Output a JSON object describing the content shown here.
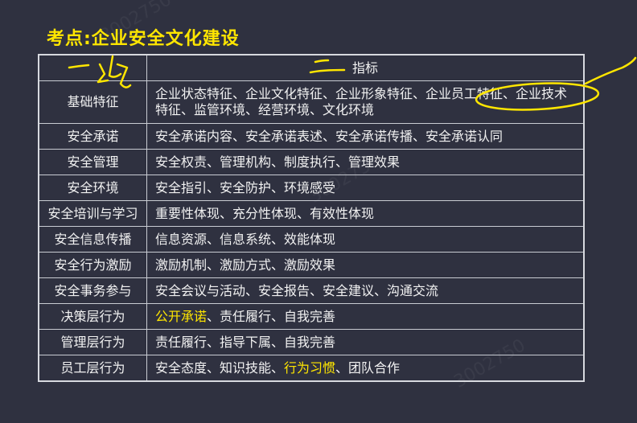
{
  "title": "考点:企业安全文化建设",
  "table": {
    "header": {
      "col1": "",
      "col2": "指标"
    },
    "rows": [
      {
        "category": "基础特征",
        "indicators": "企业状态特征、企业文化特征、企业形象特征、企业员工特征、企业技术特征、监管环境、经营环境、文化环境",
        "cat_highlight": false,
        "ind_highlight": false
      },
      {
        "category": "安全承诺",
        "indicators": "安全承诺内容、安全承诺表述、安全承诺传播、安全承诺认同",
        "cat_highlight": false,
        "ind_highlight": false
      },
      {
        "category": "安全管理",
        "indicators": "安全权责、管理机构、制度执行、管理效果",
        "cat_highlight": true,
        "ind_highlight": true
      },
      {
        "category": "安全环境",
        "indicators": "安全指引、安全防护、环境感受",
        "cat_highlight": false,
        "ind_highlight": false
      },
      {
        "category": "安全培训与学习",
        "indicators": "重要性体现、充分性体现、有效性体现",
        "cat_highlight": true,
        "ind_highlight": true
      },
      {
        "category": "安全信息传播",
        "indicators": "信息资源、信息系统、效能体现",
        "cat_highlight": false,
        "ind_highlight": false
      },
      {
        "category": "安全行为激励",
        "indicators": "激励机制、激励方式、激励效果",
        "cat_highlight": false,
        "ind_highlight": false
      },
      {
        "category": "安全事务参与",
        "indicators": "安全会议与活动、安全报告、安全建议、沟通交流",
        "cat_highlight": true,
        "ind_highlight": true
      },
      {
        "category": "决策层行为",
        "indicators_parts": [
          {
            "text": "公开承诺",
            "highlight": true
          },
          {
            "text": "、责任履行、自我完善",
            "highlight": false
          }
        ],
        "cat_highlight": true
      },
      {
        "category": "管理层行为",
        "indicators": "责任履行、指导下属、自我完善",
        "cat_highlight": true,
        "ind_highlight": false
      },
      {
        "category": "员工层行为",
        "indicators_parts": [
          {
            "text": "安全态度、知识技能、",
            "highlight": false
          },
          {
            "text": "行为习惯",
            "highlight": true
          },
          {
            "text": "、团队合作",
            "highlight": false
          }
        ],
        "cat_highlight": true
      }
    ]
  },
  "colors": {
    "background": "#2f3140",
    "highlight": "#ffe600",
    "text": "#f2f2f2",
    "ink": "#ffe600"
  },
  "watermark": "3002750"
}
